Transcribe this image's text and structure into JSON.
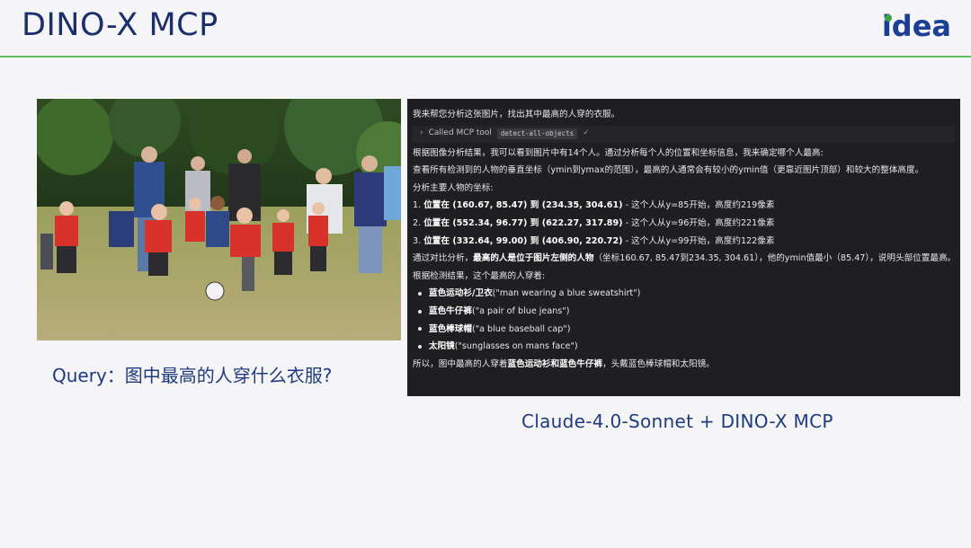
{
  "header": {
    "title": "DINO-X MCP",
    "logo_text": "idea"
  },
  "photo": {
    "description_icon": "kids-soccer-photo"
  },
  "query": {
    "text": "Query：图中最高的人穿什么衣服?"
  },
  "chat": {
    "intro": "我来帮您分析这张图片，找出其中最高的人穿的衣服。",
    "tool_label": "Called MCP tool",
    "tool_name": "detect-all-objects",
    "tool_check": "✓",
    "lines": [
      "根据图像分析结果，我可以看到图片中有14个人。通过分析每个人的位置和坐标信息，我来确定哪个人最高:",
      "查看所有检测到的人物的垂直坐标（ymin到ymax的范围），最高的人通常会有较小的ymin值（更靠近图片顶部）和较大的整体高度。",
      "分析主要人物的坐标:"
    ],
    "coords": [
      {
        "num": "1. ",
        "bold": "位置在 (160.67, 85.47) 到 (234.35, 304.61)",
        "rest": " - 这个人从y=85开始，高度约219像素"
      },
      {
        "num": "2. ",
        "bold": "位置在 (552.34, 96.77) 到 (622.27, 317.89)",
        "rest": " - 这个人从y=96开始，高度约221像素"
      },
      {
        "num": "3. ",
        "bold": "位置在 (332.64, 99.00) 到 (406.90, 220.72)",
        "rest": " - 这个人从y=99开始，高度约122像素"
      }
    ],
    "compare_pre": "通过对比分析，",
    "compare_bold": "最高的人是位于图片左侧的人物",
    "compare_post": "（坐标160.67, 85.47到234.35, 304.61），他的ymin值最小（85.47），说明头部位置最高。",
    "result_intro": "根据检测结果，这个最高的人穿着:",
    "items": [
      {
        "bold": "蓝色运动衫/卫衣",
        "rest": " (\"man wearing a blue sweatshirt\")"
      },
      {
        "bold": "蓝色牛仔裤",
        "rest": " (\"a pair of blue jeans\")"
      },
      {
        "bold": "蓝色棒球帽",
        "rest": " (\"a blue baseball cap\")"
      },
      {
        "bold": "太阳镜",
        "rest": " (\"sunglasses on mans face\")"
      }
    ],
    "conclusion_pre": "所以，图中最高的人穿着",
    "conclusion_bold": "蓝色运动衫和蓝色牛仔裤",
    "conclusion_post": "，头戴蓝色棒球帽和太阳镜。"
  },
  "caption": {
    "text": "Claude-4.0-Sonnet  +  DINO-X  MCP"
  },
  "colors": {
    "title_blue": "#1b2f6b",
    "accent_green": "#61c15a",
    "panel_bg": "#1f1f21"
  }
}
